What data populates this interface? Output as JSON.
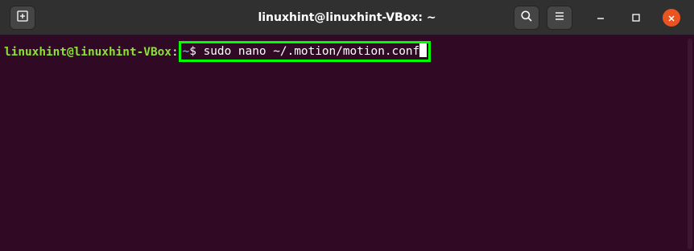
{
  "window": {
    "title": "linuxhint@linuxhint-VBox: ~"
  },
  "toolbar": {
    "new_tab_icon": "new-tab-icon",
    "search_icon": "search-icon",
    "menu_icon": "hamburger-menu-icon",
    "minimize_icon": "minimize-icon",
    "maximize_icon": "maximize-icon",
    "close_icon": "close-icon"
  },
  "terminal": {
    "prompt_user": "linuxhint@linuxhint-VBox",
    "prompt_colon": ":",
    "prompt_path": "~",
    "prompt_symbol": "$ ",
    "command": "sudo nano ~/.motion/motion.conf"
  },
  "colors": {
    "terminal_bg": "#300a24",
    "titlebar_bg": "#303030",
    "prompt_user": "#8ae234",
    "prompt_path": "#729fcf",
    "highlight_box": "#00ff00",
    "close_button": "#e95420"
  }
}
